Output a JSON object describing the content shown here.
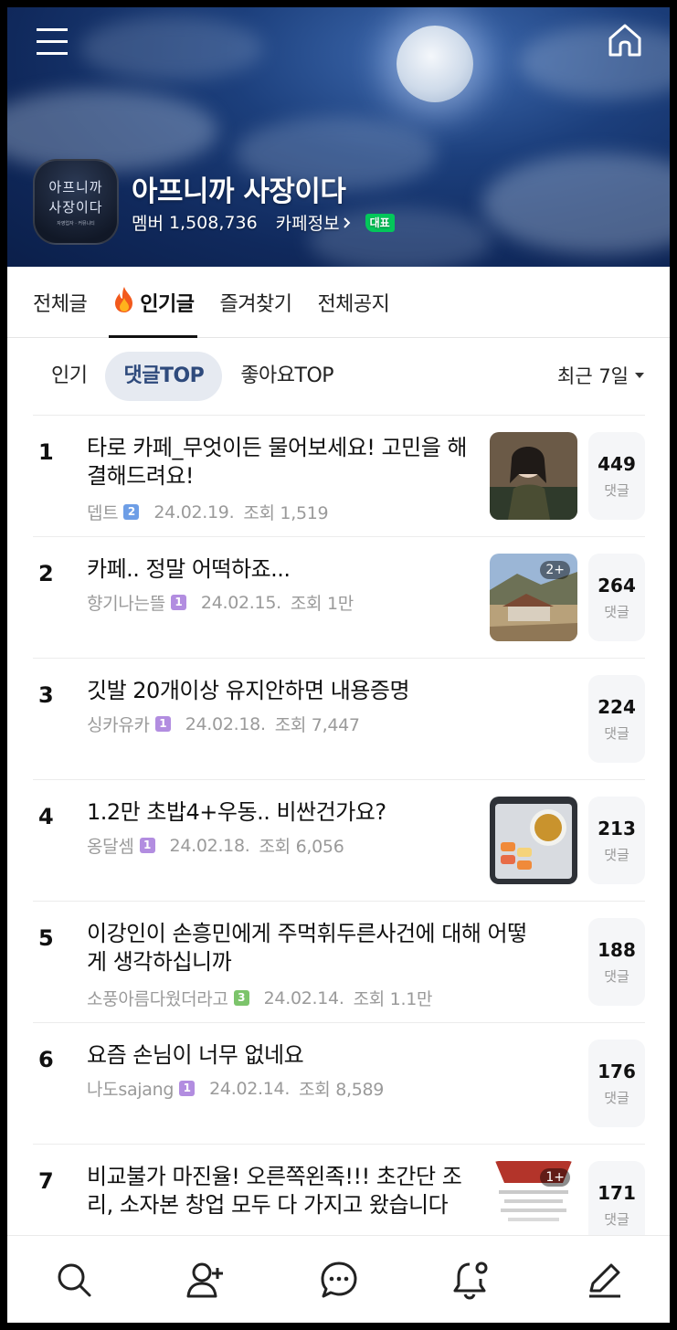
{
  "header": {
    "cafe_name": "아프니까 사장이다",
    "logo_text_line1": "아프니까",
    "logo_text_line2": "사장이다",
    "logo_subtext": "자영업자 · 커뮤니티",
    "members_label": "멤버",
    "members_count": "1,508,736",
    "cafe_info_label": "카페정보",
    "rep_badge": "대표"
  },
  "tabs": [
    {
      "label": "전체글",
      "active": false
    },
    {
      "label": "인기글",
      "active": true,
      "icon": "fire-icon"
    },
    {
      "label": "즐겨찾기",
      "active": false
    },
    {
      "label": "전체공지",
      "active": false
    }
  ],
  "filters": {
    "chips": [
      "인기",
      "댓글TOP",
      "좋아요TOP"
    ],
    "active_chip": "댓글TOP",
    "period": "최근 7일"
  },
  "comment_label": "댓글",
  "posts": [
    {
      "rank": "1",
      "title": "타로 카페_무엇이든 물어보세요! 고민을 해결해드려요!",
      "author": "뎁트",
      "level": "2",
      "level_color": "#6e9ee6",
      "date": "24.02.19.",
      "views": "조회 1,519",
      "comments": "449",
      "thumb": "person"
    },
    {
      "rank": "2",
      "title": "카페.. 정말 어떡하죠...",
      "author": "향기나는뜰",
      "level": "1",
      "level_color": "#b28de0",
      "date": "24.02.15.",
      "views": "조회 1만",
      "comments": "264",
      "thumb": "house",
      "more": "2+"
    },
    {
      "rank": "3",
      "title": "깃발 20개이상 유지안하면 내용증명",
      "author": "싱카유카",
      "level": "1",
      "level_color": "#b28de0",
      "date": "24.02.18.",
      "views": "조회 7,447",
      "comments": "224",
      "thumb": ""
    },
    {
      "rank": "4",
      "title": "1.2만 초밥4+우동.. 비싼건가요?",
      "author": "옹달셈",
      "level": "1",
      "level_color": "#b28de0",
      "date": "24.02.18.",
      "views": "조회 6,056",
      "comments": "213",
      "thumb": "sushi"
    },
    {
      "rank": "5",
      "title": "이강인이 손흥민에게 주먹휘두른사건에 대해 어떻게 생각하십니까",
      "author": "소풍아름다웠더라고",
      "level": "3",
      "level_color": "#7cc46b",
      "date": "24.02.14.",
      "views": "조회 1.1만",
      "comments": "188",
      "thumb": ""
    },
    {
      "rank": "6",
      "title": "요즘 손님이 너무 없네요",
      "author": "나도sajang",
      "level": "1",
      "level_color": "#b28de0",
      "date": "24.02.14.",
      "views": "조회 8,589",
      "comments": "176",
      "thumb": ""
    },
    {
      "rank": "7",
      "title": "비교불가 마진율! 오른쪽왼족!!! 초간단 조리, 소자본 창업 모두 다 가지고 왔습니다",
      "author": "",
      "level": "",
      "level_color": "#b28de0",
      "date": "",
      "views": "",
      "comments": "171",
      "thumb": "ad",
      "more": "1+"
    }
  ],
  "bottom_nav": [
    "search-icon",
    "add-friend-icon",
    "chat-icon",
    "notification-settings-icon",
    "write-icon"
  ],
  "colors": {
    "accent_green": "#03c75a",
    "chip_active_bg": "#e6eaf1",
    "chip_active_text": "#2e4a7c"
  }
}
